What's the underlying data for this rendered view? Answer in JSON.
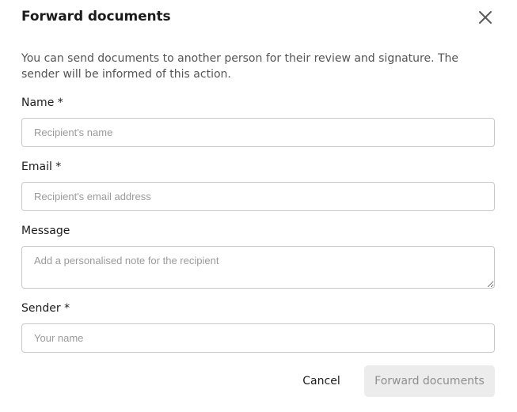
{
  "dialog": {
    "title": "Forward documents",
    "close_icon": "close-icon",
    "description": "You can send documents to another person for their review and signature. The sender will be informed of this action."
  },
  "form": {
    "name": {
      "label": "Name *",
      "value": "",
      "placeholder": "Recipient's name"
    },
    "email": {
      "label": "Email *",
      "value": "",
      "placeholder": "Recipient's email address"
    },
    "message": {
      "label": "Message",
      "value": "",
      "placeholder": "Add a personalised note for the recipient"
    },
    "sender": {
      "label": "Sender *",
      "value": "",
      "placeholder": "Your name"
    }
  },
  "actions": {
    "cancel_label": "Cancel",
    "forward_label": "Forward documents"
  },
  "colors": {
    "border": "#c9c9c9",
    "placeholder": "#9a9a9a",
    "disabled_button_bg": "#ececec",
    "disabled_button_text": "#8e8e8e"
  }
}
